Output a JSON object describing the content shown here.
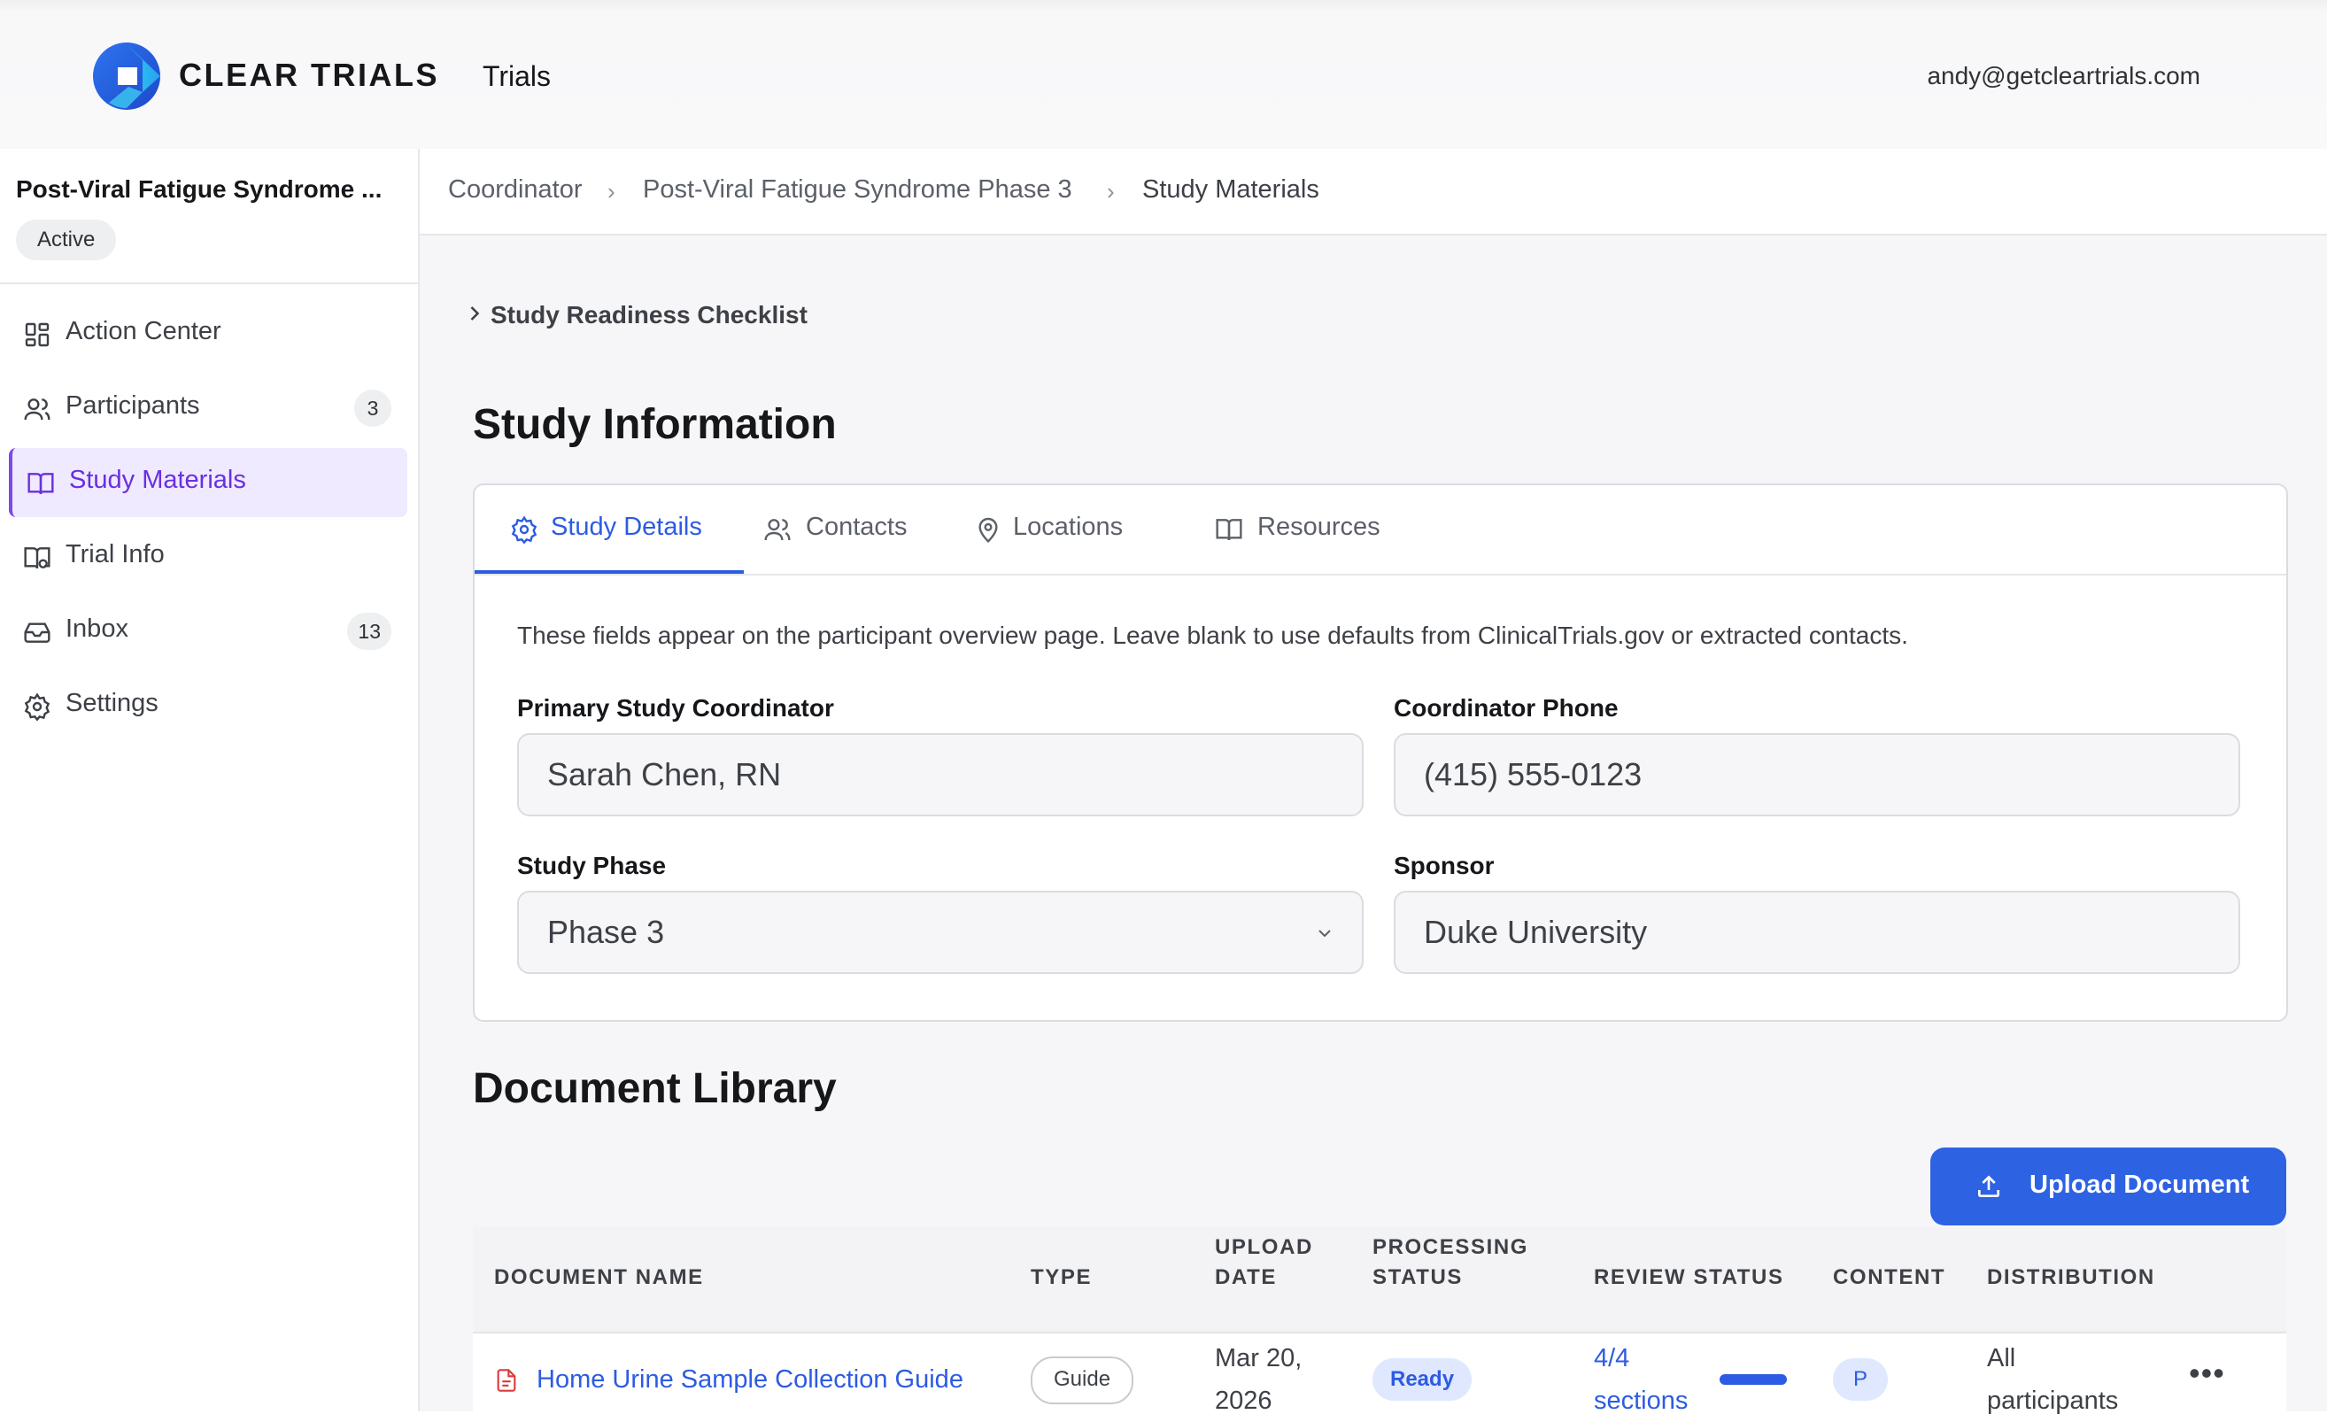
{
  "app": {
    "brand": "CLEAR TRIALS",
    "nav_trials": "Trials",
    "user_email": "andy@getcleartrials.com",
    "accent_color": "#2d5be3",
    "brand_purple": "#7b49e8"
  },
  "sidebar": {
    "study_name": "Post-Viral Fatigue Syndrome ...",
    "status": "Active",
    "items": [
      {
        "label": "Action Center",
        "icon": "grid-icon",
        "count": ""
      },
      {
        "label": "Participants",
        "icon": "users-icon",
        "count": "3"
      },
      {
        "label": "Study Materials",
        "icon": "book-open-icon",
        "count": "",
        "active": true
      },
      {
        "label": "Trial Info",
        "icon": "book-info-icon",
        "count": ""
      },
      {
        "label": "Inbox",
        "icon": "inbox-icon",
        "count": "13"
      },
      {
        "label": "Settings",
        "icon": "gear-icon",
        "count": ""
      }
    ]
  },
  "breadcrumb": {
    "items": [
      "Coordinator",
      "Post-Viral Fatigue Syndrome Phase 3",
      "Study Materials"
    ]
  },
  "checklist": {
    "label": "Study Readiness Checklist"
  },
  "study_info": {
    "title": "Study Information",
    "tabs": [
      {
        "label": "Study Details",
        "icon": "gear-icon",
        "active": true
      },
      {
        "label": "Contacts",
        "icon": "users-icon"
      },
      {
        "label": "Locations",
        "icon": "map-pin-icon"
      },
      {
        "label": "Resources",
        "icon": "book-open-icon"
      }
    ],
    "description": "These fields appear on the participant overview page. Leave blank to use defaults from ClinicalTrials.gov or extracted contacts.",
    "fields": {
      "coordinator": {
        "label": "Primary Study Coordinator",
        "value": "Sarah Chen, RN"
      },
      "phone": {
        "label": "Coordinator Phone",
        "value": "(415) 555-0123"
      },
      "phase": {
        "label": "Study Phase",
        "value": "Phase 3"
      },
      "sponsor": {
        "label": "Sponsor",
        "value": "Duke University"
      }
    }
  },
  "documents": {
    "title": "Document Library",
    "upload_label": "Upload Document",
    "columns": {
      "name": "DOCUMENT NAME",
      "type": "TYPE",
      "upload_date_1": "UPLOAD",
      "upload_date_2": "DATE",
      "processing_1": "PROCESSING",
      "processing_2": "STATUS",
      "review": "REVIEW STATUS",
      "content": "CONTENT",
      "distribution": "DISTRIBUTION"
    },
    "rows": [
      {
        "name": "Home Urine Sample Collection Guide",
        "type": "Guide",
        "date_1": "Mar 20,",
        "date_2": "2026",
        "processing": "Ready",
        "review_1": "4/4",
        "review_2": "sections",
        "review_progress": 1.0,
        "content": "P",
        "distribution_1": "All",
        "distribution_2": "participants",
        "menu": "•••"
      }
    ]
  }
}
